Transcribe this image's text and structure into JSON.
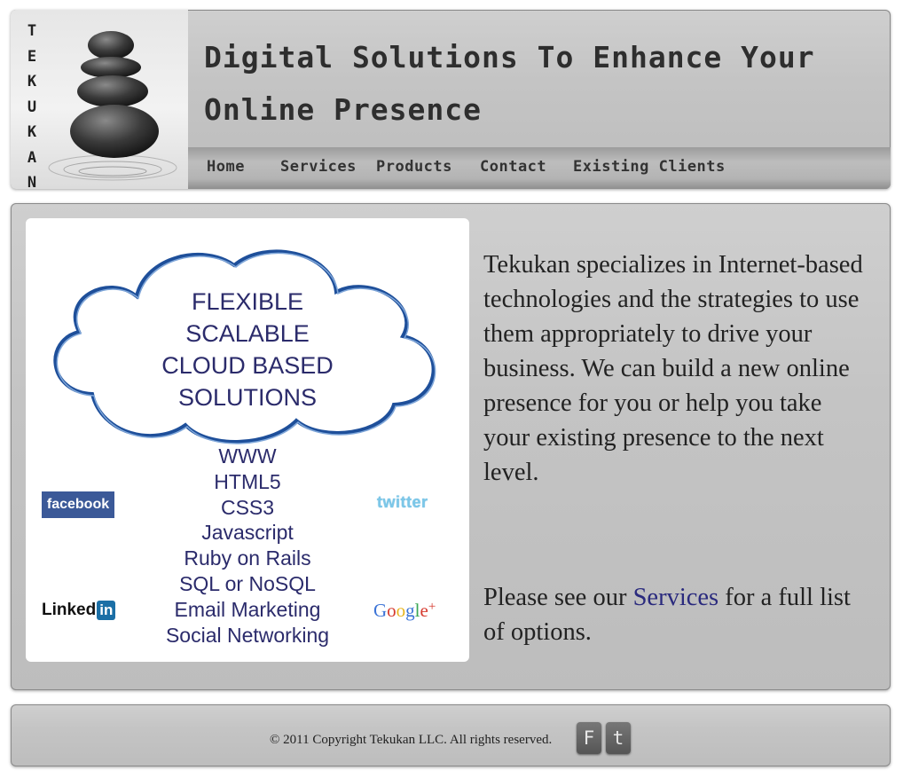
{
  "header": {
    "logo_letters": [
      "T",
      "E",
      "K",
      "U",
      "K",
      "A",
      "N"
    ],
    "tagline_line1": "Digital Solutions To Enhance Your",
    "tagline_line2": "Online Presence",
    "nav": [
      "Home",
      "Services",
      "Products",
      "Contact",
      "Existing Clients"
    ]
  },
  "promo_image": {
    "cloud_lines": [
      "FLEXIBLE",
      "SCALABLE",
      "CLOUD BASED",
      "SOLUTIONS"
    ],
    "technologies": [
      "WWW",
      "HTML5",
      "CSS3",
      "Javascript",
      "Ruby on Rails",
      "SQL or NoSQL",
      "Email Marketing",
      "Social Networking"
    ],
    "logos": {
      "facebook": "facebook",
      "twitter": "twitter",
      "linkedin_text": "Linked",
      "linkedin_in": "in",
      "google": [
        "G",
        "o",
        "o",
        "g",
        "l",
        "e",
        "+"
      ]
    }
  },
  "main": {
    "description": "Tekukan specializes in Internet-based technologies and the strategies to use them appropriately to drive your business. We can build a new online presence for you or help you take your existing presence to the next level.",
    "see_prefix": "Please see our ",
    "services_link": "Services",
    "see_suffix": " for a full list of options."
  },
  "footer": {
    "copyright": "© 2011 Copyright Tekukan LLC. All rights reserved.",
    "facebook_btn": "F",
    "twitter_btn": "t"
  },
  "colors": {
    "accent_text": "#2b2b6b",
    "link": "#2a2a7e",
    "google": [
      "#3b73d6",
      "#d63b2f",
      "#e8b521",
      "#3b73d6",
      "#3aa655",
      "#d63b2f",
      "#d63b2f"
    ]
  }
}
